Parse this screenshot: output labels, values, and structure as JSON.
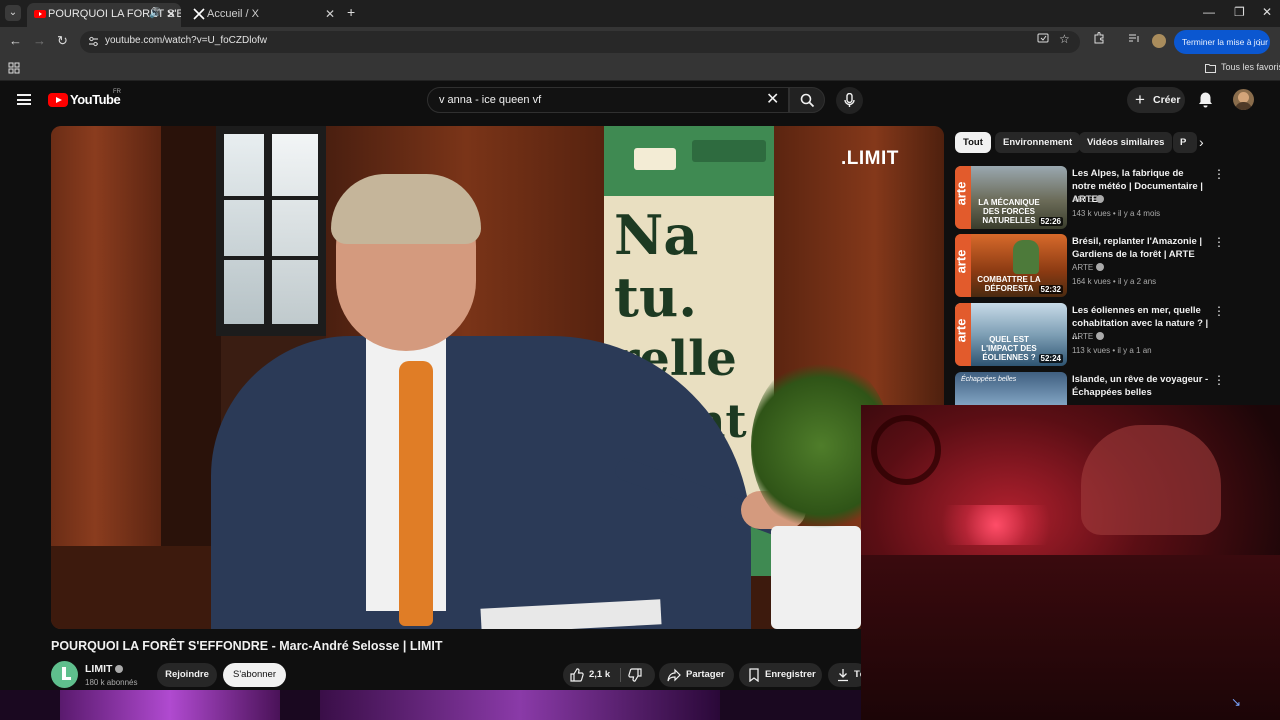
{
  "browser": {
    "tabs": [
      {
        "title": "POURQUOI LA FORÊT S'EFF",
        "active": true
      },
      {
        "title": "Accueil / X",
        "active": false
      }
    ],
    "url": "youtube.com/watch?v=U_foCZDlofw",
    "update_button": "Terminer la mise à jour",
    "bookmarks_all": "Tous les favoris"
  },
  "youtube": {
    "logo_text": "YouTube",
    "region": "FR",
    "search_query": "v anna - ice queen vf",
    "create_label": "Créer"
  },
  "player": {
    "watermark": ".LIMIT",
    "banner_lines": [
      "Na",
      "tu.",
      "relle",
      "ment"
    ]
  },
  "video": {
    "title": "POURQUOI LA FORÊT S'EFFONDRE - Marc-André Selosse | LIMIT",
    "channel": "LIMIT",
    "subscribers": "180 k abonnés",
    "join_label": "Rejoindre",
    "subscribe_label": "S'abonner",
    "likes": "2,1 k",
    "share_label": "Partager",
    "save_label": "Enregistrer",
    "download_label": "Té"
  },
  "chips": [
    "Tout",
    "Environnement",
    "Vidéos similaires",
    "P"
  ],
  "recommendations": [
    {
      "title": "Les Alpes, la fabrique de notre météo | Documentaire | ARTE",
      "channel": "ARTE",
      "meta": "143 k vues • il y a 4 mois",
      "duration": "52:26",
      "caption": "LA MÉCANIQUE DES FORCES NATURELLES",
      "brand": "arte"
    },
    {
      "title": "Brésil, replanter l'Amazonie | Gardiens de la forêt | ARTE",
      "channel": "ARTE",
      "meta": "164 k vues • il y a 2 ans",
      "duration": "52:32",
      "caption": "COMBATTRE LA DÉFORESTA",
      "brand": "arte"
    },
    {
      "title": "Les éoliennes en mer, quelle cohabitation avec la nature ? | ...",
      "channel": "ARTE",
      "meta": "113 k vues • il y a 1 an",
      "duration": "52:24",
      "caption": "QUEL EST L'IMPACT DES ÉOLIENNES ?",
      "brand": "arte"
    },
    {
      "title": "Islande, un rêve de voyageur - Échappées belles",
      "channel": "Échappées belles",
      "meta": "",
      "duration": "",
      "caption": "",
      "brand": "Échappées belles"
    }
  ]
}
